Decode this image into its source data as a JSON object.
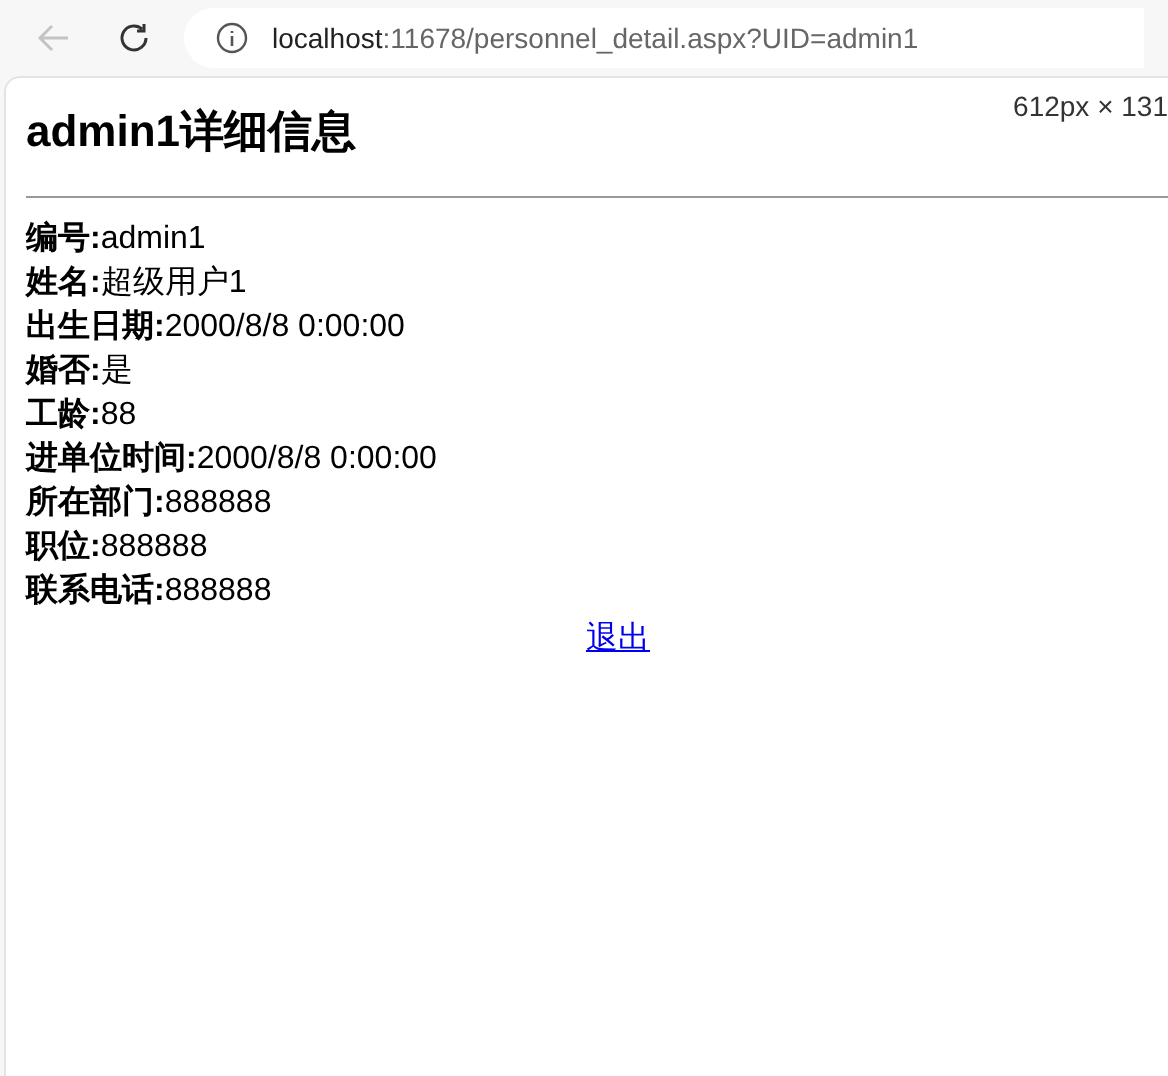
{
  "browser": {
    "url_host": "localhost",
    "url_rest": ":11678/personnel_detail.aspx?UID=admin1"
  },
  "size_overlay": "612px × 131",
  "title": "admin1详细信息",
  "fields": [
    {
      "label": "编号:",
      "value": "admin1"
    },
    {
      "label": "姓名:",
      "value": "超级用户1"
    },
    {
      "label": "出生日期:",
      "value": "2000/8/8 0:00:00"
    },
    {
      "label": "婚否:",
      "value": "是"
    },
    {
      "label": "工龄:",
      "value": "88"
    },
    {
      "label": "进单位时间:",
      "value": "2000/8/8 0:00:00"
    },
    {
      "label": "所在部门:",
      "value": "888888"
    },
    {
      "label": "职位:",
      "value": "888888"
    },
    {
      "label": "联系电话:",
      "value": "888888"
    }
  ],
  "exit_link": "退出"
}
